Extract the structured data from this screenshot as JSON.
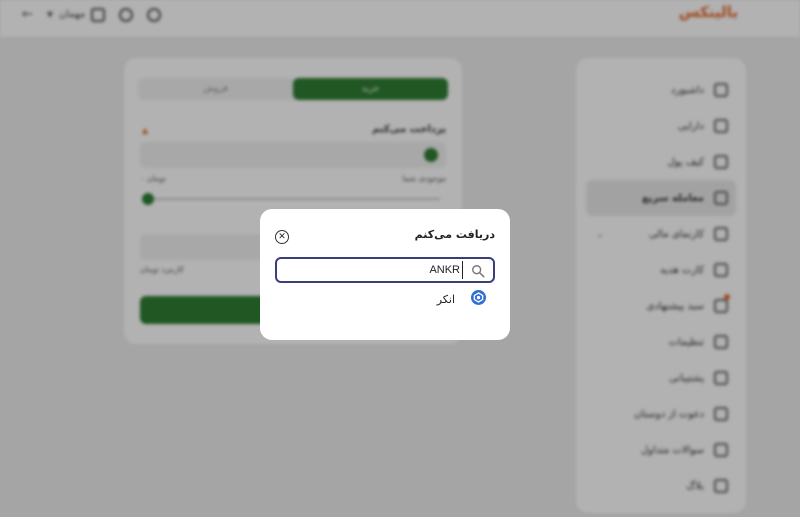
{
  "app": {
    "logo_text": "بالینکس",
    "user_label": "مهمان"
  },
  "sidebar": {
    "items": [
      {
        "label": "داشبورد"
      },
      {
        "label": "دارایی"
      },
      {
        "label": "کیف پول"
      },
      {
        "label": "معامله سریع"
      },
      {
        "label": "کارنمای مالی"
      },
      {
        "label": "کارت هدیه"
      },
      {
        "label": "سبد پیشنهادی"
      },
      {
        "label": "تنظیمات"
      },
      {
        "label": "پشتیبانی"
      },
      {
        "label": "دعوت از دوستان"
      },
      {
        "label": "سوالات متداول"
      },
      {
        "label": "بلاگ"
      }
    ]
  },
  "trade_card": {
    "tab_buy": "خرید",
    "tab_sell": "فروش",
    "pay_label": "پرداخت می‌کنم",
    "balance_right": "موجودی شما",
    "balance_left": "۰ تومان",
    "receive_note": "کارمزد تومان"
  },
  "modal": {
    "title": "دریافت می‌کنم",
    "search_value": "ANKR",
    "results": [
      {
        "name": "انکر",
        "icon": "ankr-coin-icon"
      }
    ]
  },
  "colors": {
    "brand_green": "#2e7d32",
    "accent_orange": "#e46a2e",
    "search_border": "#3a3f7a",
    "ankr_blue": "#2f6fd6"
  }
}
